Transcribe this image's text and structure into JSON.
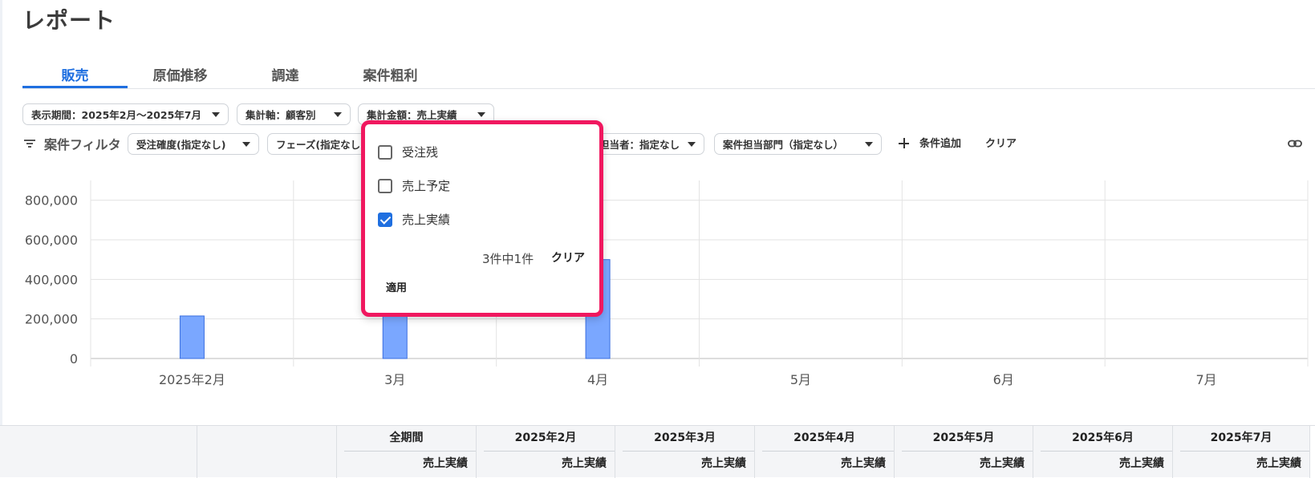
{
  "page": {
    "title": "レポート"
  },
  "tabs": [
    {
      "label": "販売",
      "active": true
    },
    {
      "label": "原価推移",
      "active": false
    },
    {
      "label": "調達",
      "active": false
    },
    {
      "label": "案件粗利",
      "active": false
    }
  ],
  "toolbar": {
    "period": "表示期間：2025年2月〜2025年7月",
    "axis": "集計軸：顧客別",
    "amount": "集計金額：売上実績"
  },
  "filters": {
    "label": "案件フィルタ",
    "order_confidence": "受注確度(指定なし)",
    "phase": "フェーズ(指定なし)",
    "owner": "担当者：指定なし",
    "department": "案件担当部門（指定なし）",
    "add_condition": "条件追加",
    "clear": "クリア",
    "icons": {
      "filter": "filter-icon",
      "link": "link-icon",
      "add": "plus-icon"
    }
  },
  "popup": {
    "options": [
      {
        "label": "受注残",
        "checked": false
      },
      {
        "label": "売上予定",
        "checked": false
      },
      {
        "label": "売上実績",
        "checked": true
      }
    ],
    "count_text": "3件中1件",
    "clear": "クリア",
    "apply": "適用",
    "border_color": "#f0185f"
  },
  "chart_data": {
    "type": "bar",
    "categories": [
      "2025年2月",
      "3月",
      "4月",
      "5月",
      "6月",
      "7月"
    ],
    "values": [
      215000,
      230000,
      500000,
      0,
      0,
      0
    ],
    "yticks": [
      "0",
      "200,000",
      "400,000",
      "600,000",
      "800,000"
    ],
    "ylim": [
      0,
      900000
    ],
    "grid": true,
    "bar_color": "#7aa7ff",
    "bar_stroke": "#3a6fe0"
  },
  "table": {
    "headers": [
      "全期間",
      "2025年2月",
      "2025年3月",
      "2025年4月",
      "2025年5月",
      "2025年6月",
      "2025年7月"
    ],
    "sub_header": "売上実績"
  },
  "colors": {
    "accent": "#1f6fe0",
    "highlight": "#f0185f"
  }
}
